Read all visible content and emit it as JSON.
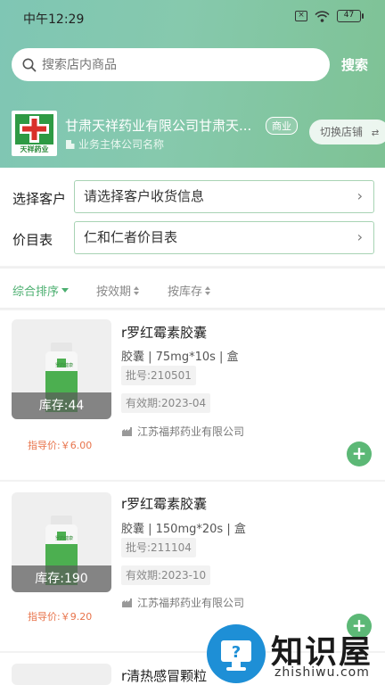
{
  "status_bar": {
    "time": "中午12:29",
    "battery": "47"
  },
  "search": {
    "placeholder": "搜索店内商品",
    "button": "搜索"
  },
  "store": {
    "name": "甘肃天祥药业有限公司甘肃天...",
    "badge": "商业",
    "sub": "业务主体公司名称",
    "switch_label": "切换店铺",
    "logo_text": "天祥药业"
  },
  "filters": {
    "customer_label": "选择客户",
    "customer_value": "请选择客户收货信息",
    "price_label": "价目表",
    "price_value": "仁和仁者价目表"
  },
  "sort": {
    "overall": "综合排序",
    "expiry": "按效期",
    "stock": "按库存"
  },
  "products": [
    {
      "name": "r罗红霉素胶囊",
      "spec": "胶囊 | 75mg*10s | 盒",
      "batch": "批号:210501",
      "expiry": "有效期:2023-04",
      "maker": "江苏福邦药业有限公司",
      "stock": "库存:44",
      "guide_price": "指导价:￥6.00",
      "pkg_text": "罗药健康"
    },
    {
      "name": "r罗红霉素胶囊",
      "spec": "胶囊 | 150mg*20s | 盒",
      "batch": "批号:211104",
      "expiry": "有效期:2023-10",
      "maker": "江苏福邦药业有限公司",
      "stock": "库存:190",
      "guide_price": "指导价:￥9.20",
      "pkg_text": "罗药健康"
    },
    {
      "name": "r清热感冒颗粒"
    }
  ],
  "watermark": {
    "title": "知识屋",
    "url": "zhishiwu.com"
  },
  "colors": {
    "accent": "#4caf70",
    "price": "#e8744c",
    "hero_start": "#7fc6b4",
    "hero_end": "#7ec294"
  }
}
